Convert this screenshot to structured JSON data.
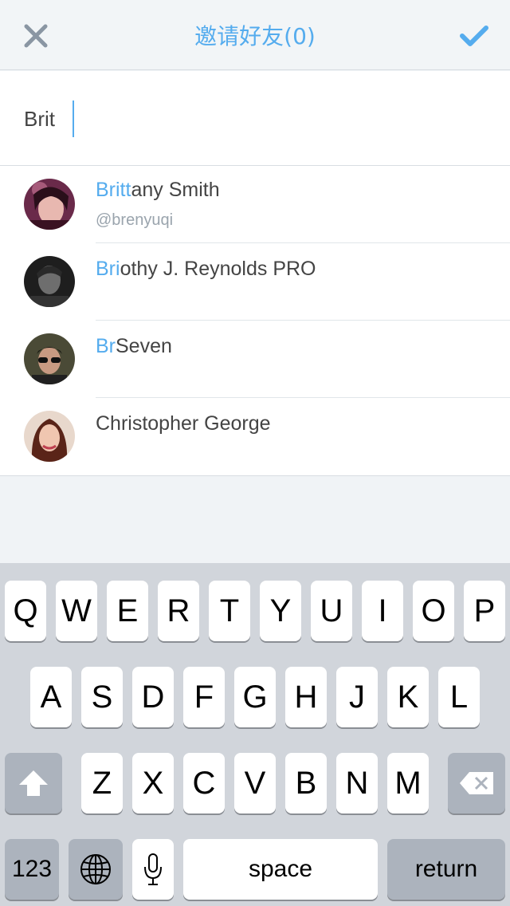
{
  "header": {
    "title": "邀请好友(0)",
    "close_icon": "close-icon",
    "done_icon": "checkmark-icon",
    "accent": "#55acee"
  },
  "search": {
    "value": "Brit"
  },
  "results": [
    {
      "highlight": "Britt",
      "rest": "any Smith",
      "handle": "@brenyuqi"
    },
    {
      "highlight": "Bri",
      "rest": "othy J. Reynolds PRO",
      "handle": ""
    },
    {
      "highlight": "Br",
      "rest": "Seven",
      "handle": ""
    },
    {
      "highlight": "",
      "rest": "Christopher George",
      "handle": ""
    }
  ],
  "keyboard": {
    "row1": [
      "Q",
      "W",
      "E",
      "R",
      "T",
      "Y",
      "U",
      "I",
      "O",
      "P"
    ],
    "row2": [
      "A",
      "S",
      "D",
      "F",
      "G",
      "H",
      "J",
      "K",
      "L"
    ],
    "row3": [
      "Z",
      "X",
      "C",
      "V",
      "B",
      "N",
      "M"
    ],
    "numbers_label": "123",
    "space_label": "space",
    "return_label": "return"
  }
}
